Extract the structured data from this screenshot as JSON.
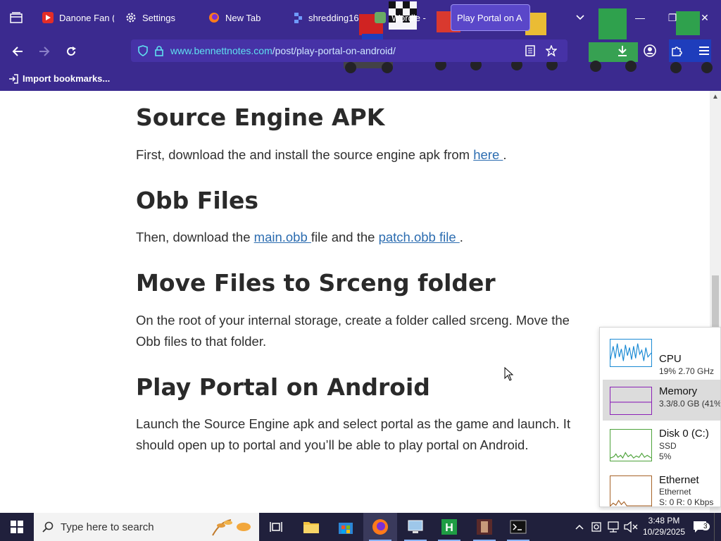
{
  "browser": {
    "tabs": [
      {
        "label": "Danone Fan (",
        "icon": "youtube-icon"
      },
      {
        "label": "Settings",
        "icon": "gear-icon"
      },
      {
        "label": "New Tab",
        "icon": "firefox-icon"
      },
      {
        "label": "shredding16",
        "icon": "replit-icon"
      },
      {
        "label": "Wordle -",
        "icon": "page-icon"
      },
      {
        "label": "Play Portal on A",
        "icon": "page-icon",
        "active": true
      }
    ],
    "url_host": "www.bennettnotes.com",
    "url_path": "/post/play-portal-on-android/",
    "bookmark_import_label": "Import bookmarks..."
  },
  "article": {
    "sections": [
      {
        "heading": "Source Engine APK",
        "text_before": "First, download the and install the source engine apk from ",
        "link1": "here ",
        "text_mid": ".",
        "link2": "",
        "text_after": ""
      },
      {
        "heading": "Obb Files",
        "text_before": "Then, download the ",
        "link1": "main.obb ",
        "text_mid": "file and the ",
        "link2": "patch.obb file ",
        "text_after": "."
      },
      {
        "heading": "Move Files to Srceng folder",
        "text_before": "On the root of your internal storage, create a folder called srceng. Move the Obb files to that folder.",
        "link1": "",
        "text_mid": "",
        "link2": "",
        "text_after": ""
      },
      {
        "heading": "Play Portal on Android",
        "text_before": "Launch the Source Engine apk and select portal as the game and launch. It should open up to portal and you’ll be able to play portal on Android.",
        "link1": "",
        "text_mid": "",
        "link2": "",
        "text_after": ""
      }
    ]
  },
  "performance": {
    "cpu": {
      "name": "CPU",
      "detail": "19% 2.70 GHz",
      "color": "#1a8ad4"
    },
    "memory": {
      "name": "Memory",
      "detail": "3.3/8.0 GB (41%)",
      "color": "#8b22b7"
    },
    "disk": {
      "name": "Disk 0 (C:)",
      "type": "SSD",
      "detail": "5%",
      "color": "#4da23a"
    },
    "ethernet": {
      "name": "Ethernet",
      "type": "Ethernet",
      "detail": "S: 0  R: 0 Kbps",
      "color": "#a76328"
    }
  },
  "taskbar": {
    "search_placeholder": "Type here to search",
    "time": "3:48 PM",
    "date": "10/29/2025",
    "notification_count": "3"
  },
  "colors": {
    "chrome_bg": "#3b2a8f",
    "link": "#2b6cb0",
    "taskbar_bg": "#20203c"
  }
}
